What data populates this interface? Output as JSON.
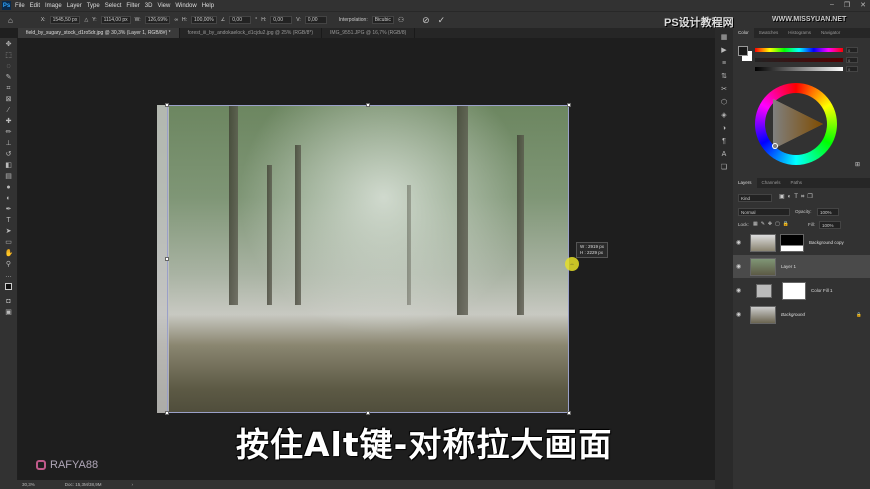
{
  "app": {
    "logo": "Ps",
    "menu": [
      "File",
      "Edit",
      "Image",
      "Layer",
      "Type",
      "Select",
      "Filter",
      "3D",
      "View",
      "Window",
      "Help"
    ],
    "window_controls": [
      "minimize",
      "restore",
      "close"
    ]
  },
  "options": {
    "x_label": "X:",
    "x": "1545,50 px",
    "y_label": "Y:",
    "y": "1114,00 px",
    "w_label": "W:",
    "w": "126,69%",
    "h_label": "H:",
    "h": "100,00%",
    "angle": "0,00",
    "angle_unit": "°",
    "hskew_label": "H:",
    "hskew": "0,00",
    "vskew_label": "V:",
    "vskew": "0,00",
    "interp_label": "Interpolation:",
    "interp": "Bicubic"
  },
  "tabs": [
    {
      "label": "field_by_sugary_stock_d1ro5dr.jpg @ 30,3% (Layer 1, RGB/8#) *",
      "active": true
    },
    {
      "label": "forest_iii_by_andokaelock_d1cjdu2.jpg @ 25% (RGB/8*)",
      "active": false
    },
    {
      "label": "IMG_9551.JPG @ 16,7% (RGB/8)",
      "active": false
    }
  ],
  "transform_tip": {
    "w": "W : 2919 px",
    "h": "H : 2229 px"
  },
  "subtitle": "按住Alt键-对称拉大画面",
  "watermark": "RAFYA88",
  "brand": {
    "cn": "PS设计教程网",
    "url": "WWW.MISSYUAN.NET"
  },
  "status": {
    "zoom": "30,3%",
    "doc": "Doc: 15,3M/38,9M"
  },
  "color_panel": {
    "tabs": [
      "Color",
      "Swatches",
      "Histograms",
      "Navigator"
    ],
    "values": [
      "0",
      "0",
      "0"
    ],
    "colors": {
      "foreground": "#1a1a1a",
      "background": "#ffffff"
    }
  },
  "layers_panel": {
    "tabs": [
      "Layers",
      "Channels",
      "Paths"
    ],
    "filter": "Kind",
    "blend": "Normal",
    "opacity_label": "Opacity:",
    "opacity": "100%",
    "lock_label": "Lock:",
    "fill_label": "Fill:",
    "fill": "100%",
    "layers": [
      {
        "name": "Background copy",
        "selected": false
      },
      {
        "name": "Layer 1",
        "selected": true
      },
      {
        "name": "Color Fill 1",
        "selected": false
      },
      {
        "name": "Background",
        "selected": false,
        "locked": true
      }
    ]
  }
}
